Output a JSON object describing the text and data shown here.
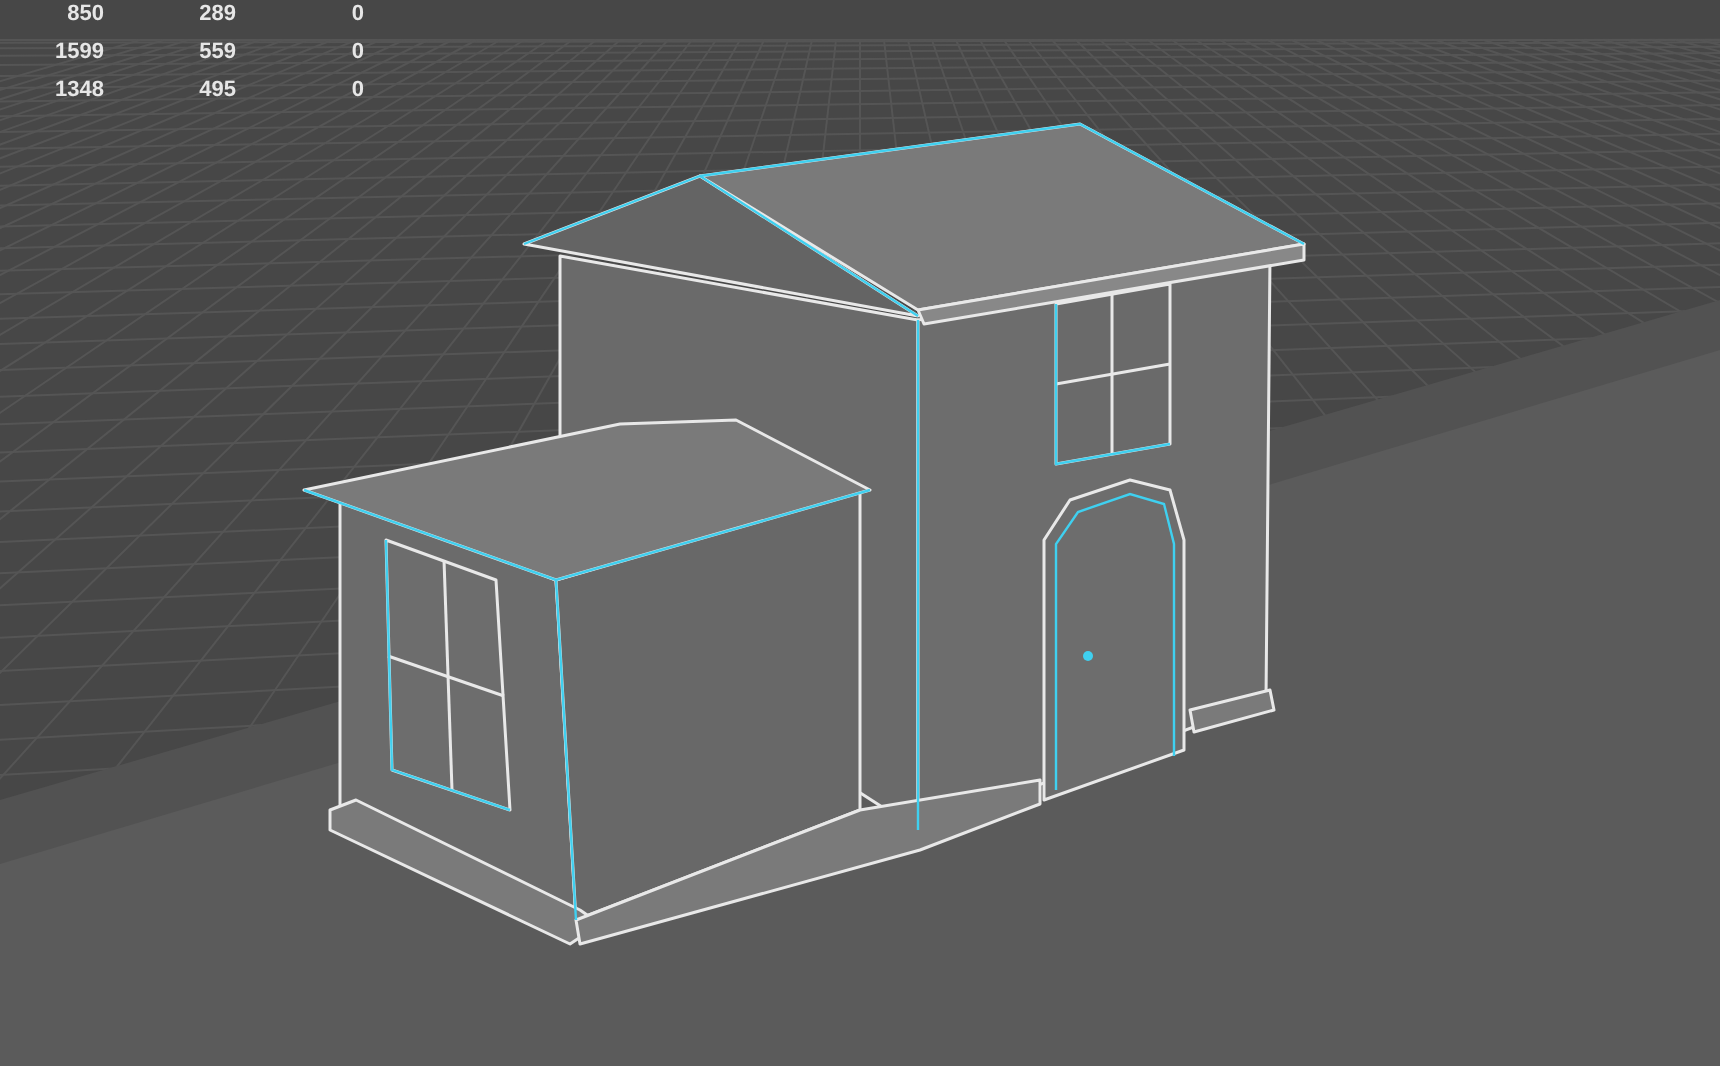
{
  "stats": {
    "rows": [
      {
        "cells": [
          "850",
          "289",
          "0"
        ]
      },
      {
        "cells": [
          "1599",
          "559",
          "0"
        ]
      },
      {
        "cells": [
          "1348",
          "495",
          "0"
        ]
      }
    ]
  }
}
